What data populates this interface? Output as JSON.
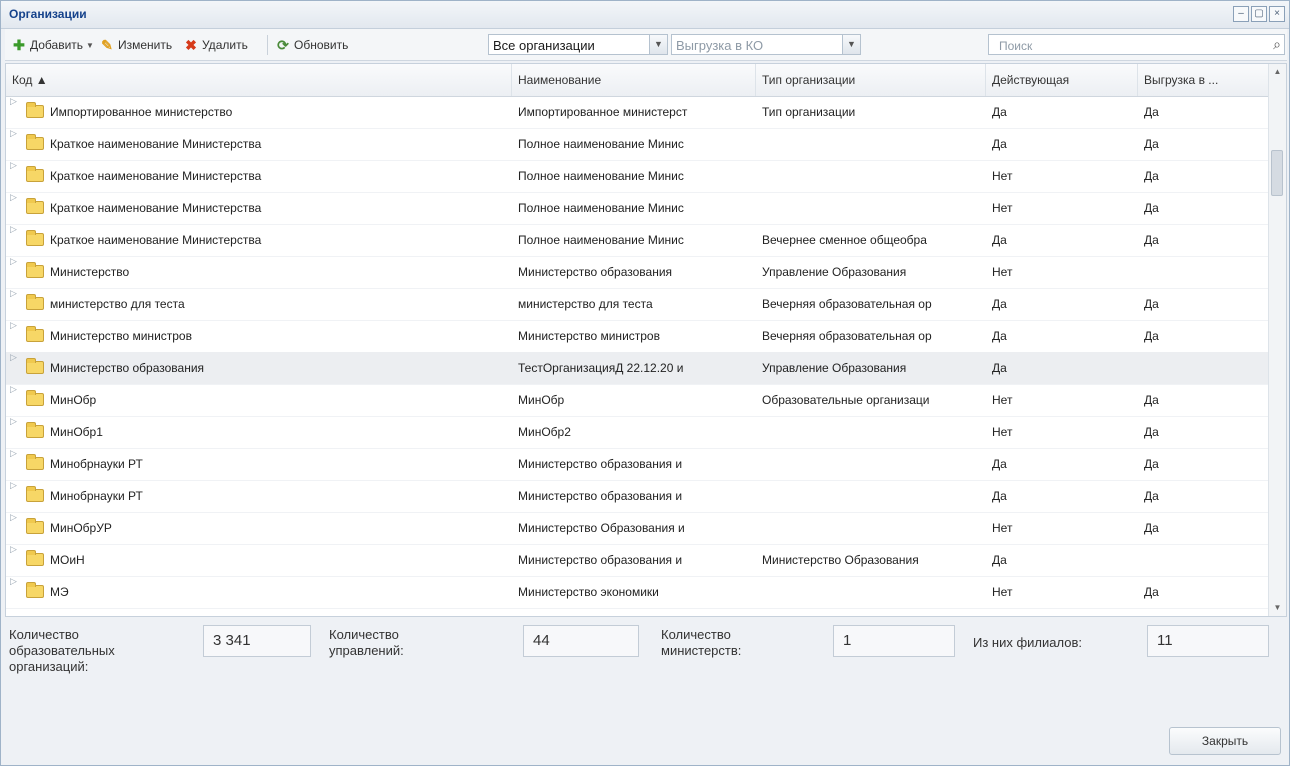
{
  "window": {
    "title": "Организации"
  },
  "toolbar": {
    "add_label": "Добавить",
    "edit_label": "Изменить",
    "delete_label": "Удалить",
    "refresh_label": "Обновить",
    "filter_value": "Все организации",
    "export_value": "Выгрузка в КО",
    "search_placeholder": "Поиск"
  },
  "grid": {
    "columns": [
      "Код ▲",
      "Наименование",
      "Тип организации",
      "Действующая",
      "Выгрузка в ..."
    ],
    "rows": [
      {
        "code": "Импортированное министерство",
        "name": "Импортированное министерст",
        "type": "Тип организации",
        "active": "Да",
        "export": "Да"
      },
      {
        "code": "Краткое наименование Министерства",
        "name": "Полное наименование Минис",
        "type": "",
        "active": "Да",
        "export": "Да"
      },
      {
        "code": "Краткое наименование Министерства",
        "name": "Полное наименование Минис",
        "type": "",
        "active": "Нет",
        "export": "Да"
      },
      {
        "code": "Краткое наименование Министерства",
        "name": "Полное наименование Минис",
        "type": "",
        "active": "Нет",
        "export": "Да"
      },
      {
        "code": "Краткое наименование Министерства",
        "name": "Полное наименование Минис",
        "type": "Вечернее сменное общеобра",
        "active": "Да",
        "export": "Да"
      },
      {
        "code": "Министерство",
        "name": "Министерство образования",
        "type": "Управление Образования",
        "active": "Нет",
        "export": ""
      },
      {
        "code": "министерство для теста",
        "name": "министерство для теста",
        "type": "Вечерняя образовательная ор",
        "active": "Да",
        "export": "Да"
      },
      {
        "code": "Министерство министров",
        "name": "Министерство министров",
        "type": "Вечерняя образовательная ор",
        "active": "Да",
        "export": "Да"
      },
      {
        "code": "Министерство образования",
        "name": "ТестОрганизацияД 22.12.20 и",
        "type": "Управление Образования",
        "active": "Да",
        "export": ""
      },
      {
        "code": "МинОбр",
        "name": "МинОбр",
        "type": "Образовательные организаци",
        "active": "Нет",
        "export": "Да"
      },
      {
        "code": "МинОбр1",
        "name": "МинОбр2",
        "type": "",
        "active": "Нет",
        "export": "Да"
      },
      {
        "code": "Минобрнауки РТ",
        "name": "Министерство образования и",
        "type": "",
        "active": "Да",
        "export": "Да"
      },
      {
        "code": "Минобрнауки РТ",
        "name": "Министерство образования и",
        "type": "",
        "active": "Да",
        "export": "Да"
      },
      {
        "code": "МинОбрУР",
        "name": "Министерство Образования и",
        "type": "",
        "active": "Нет",
        "export": "Да"
      },
      {
        "code": "МОиН",
        "name": "Министерство образования и",
        "type": "Министерство Образования",
        "active": "Да",
        "export": ""
      },
      {
        "code": "МЭ",
        "name": "Министерство экономики",
        "type": "",
        "active": "Нет",
        "export": "Да"
      }
    ],
    "selected_row": 8
  },
  "stats": {
    "edu_orgs_label": "Количество образовательных организаций:",
    "edu_orgs_value": "3 341",
    "mgmt_label": "Количество управлений:",
    "mgmt_value": "44",
    "ministries_label": "Количество министерств:",
    "ministries_value": "1",
    "branches_label": "Из них филиалов:",
    "branches_value": "11"
  },
  "footer": {
    "close_label": "Закрыть"
  }
}
